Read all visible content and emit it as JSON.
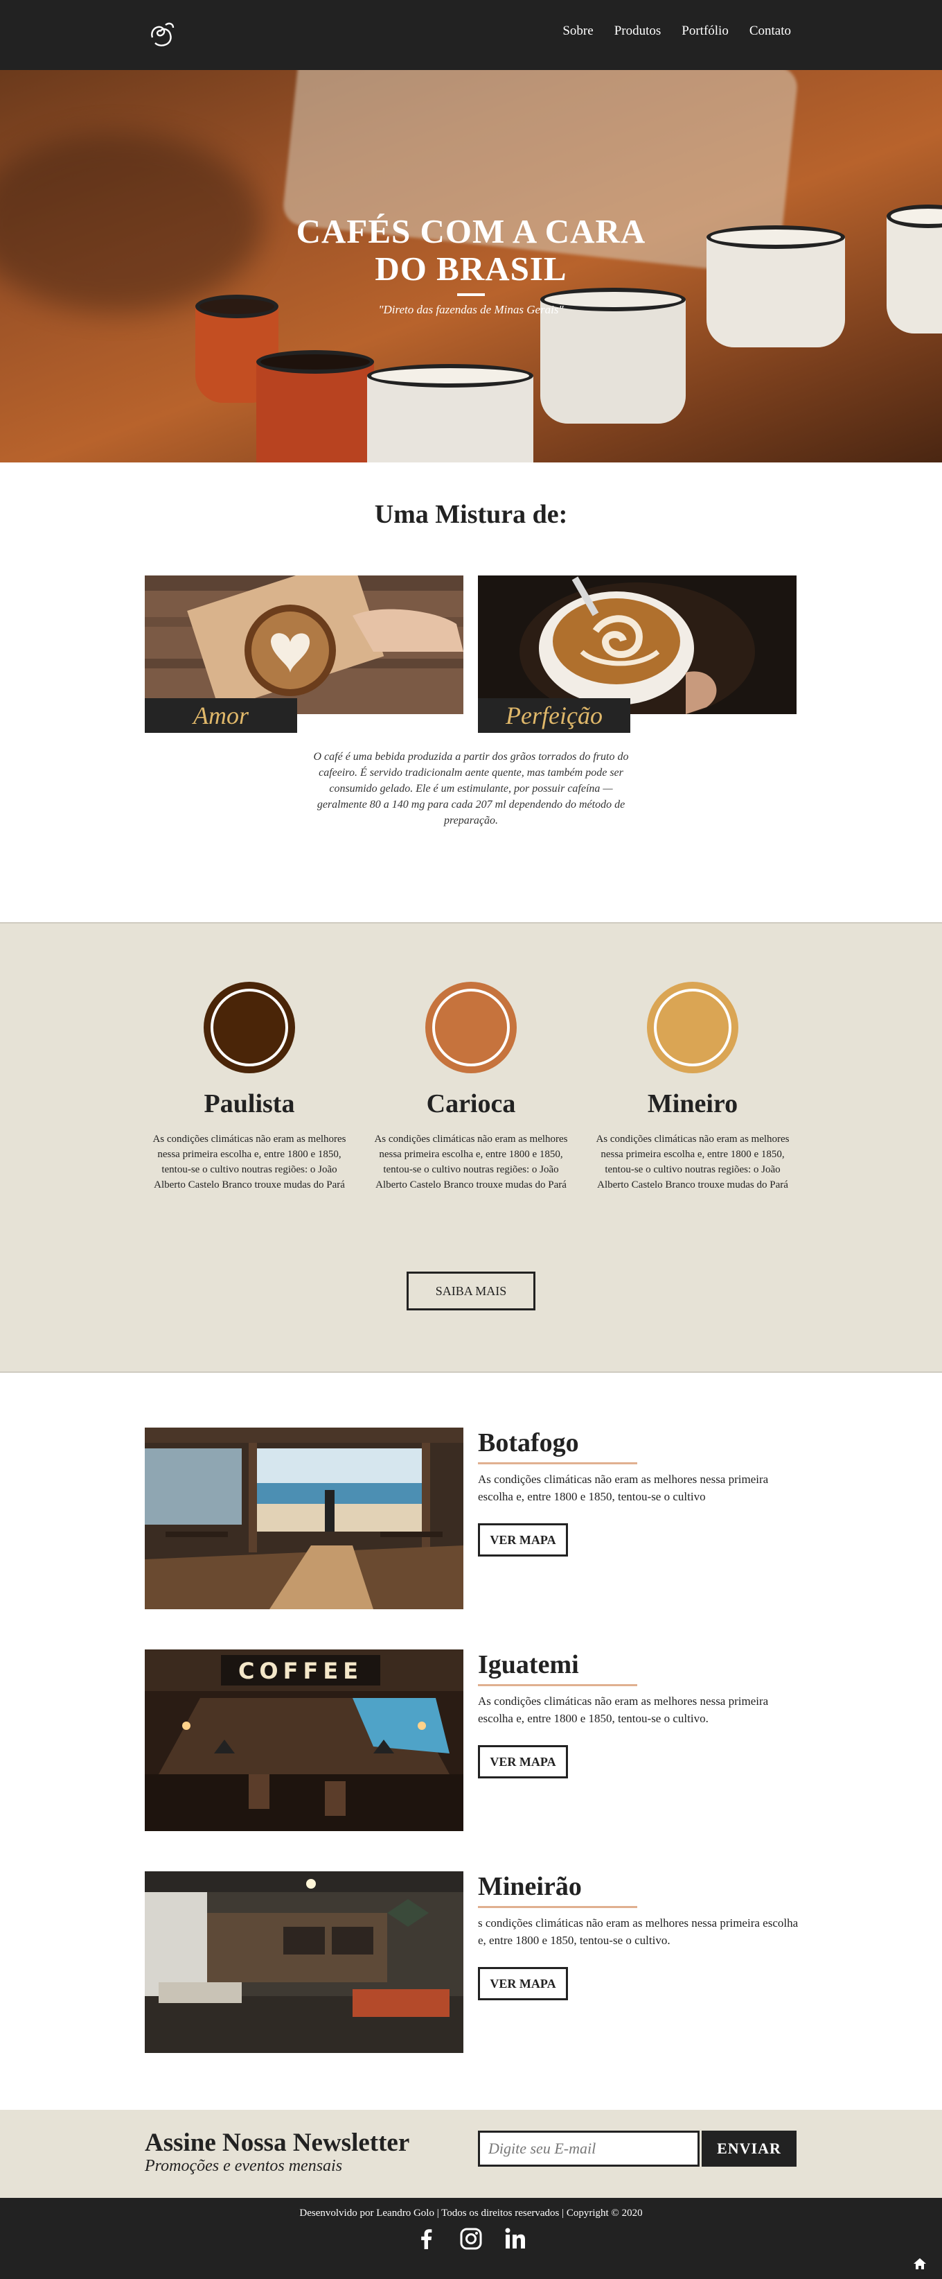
{
  "nav": {
    "items": [
      "Sobre",
      "Produtos",
      "Portfólio",
      "Contato"
    ]
  },
  "hero": {
    "title": "CAFÉS COM A CARA DO BRASIL",
    "subtitle": "\"Direto das fazendas de Minas Gerais\""
  },
  "mistura": {
    "title": "Uma Mistura de:",
    "cards": [
      {
        "label": "Amor"
      },
      {
        "label": "Perfeição"
      }
    ],
    "description": "O café é uma bebida produzida a partir dos grãos torrados do fruto do cafeeiro. É servido tradicionalm aente quente, mas também pode ser consumido gelado. Ele é um estimulante, por possuir cafeína — geralmente 80 a 140 mg para cada 207 ml dependendo do método de preparação."
  },
  "origens": {
    "items": [
      {
        "name": "Paulista",
        "color": "#4a2508",
        "text": "As condições climáticas não eram as melhores nessa primeira escolha e, entre 1800 e 1850, tentou-se o cultivo noutras regiões: o João Alberto Castelo Branco trouxe mudas do Pará"
      },
      {
        "name": "Carioca",
        "color": "#c6733d",
        "text": "As condições climáticas não eram as melhores nessa primeira escolha e, entre 1800 e 1850, tentou-se o cultivo noutras regiões: o João Alberto Castelo Branco trouxe mudas do Pará"
      },
      {
        "name": "Mineiro",
        "color": "#daa554",
        "text": "As condições climáticas não eram as melhores nessa primeira escolha e, entre 1800 e 1850, tentou-se o cultivo noutras regiões: o João Alberto Castelo Branco trouxe mudas do Pará"
      }
    ],
    "button": "SAIBA MAIS"
  },
  "lojas": [
    {
      "name": "Botafogo",
      "text": "As condições climáticas não eram as melhores nessa primeira escolha e, entre 1800 e 1850, tentou-se o cultivo",
      "button": "VER MAPA"
    },
    {
      "name": "Iguatemi",
      "text": "As condições climáticas não eram as melhores nessa primeira escolha e, entre 1800 e 1850, tentou-se o cultivo.",
      "button": "VER MAPA",
      "sign": "COFFEE"
    },
    {
      "name": "Mineirão",
      "text": "s condições climáticas não eram as melhores nessa primeira escolha e, entre 1800 e 1850, tentou-se o cultivo.",
      "button": "VER MAPA"
    }
  ],
  "newsletter": {
    "title": "Assine Nossa Newsletter",
    "subtitle": "Promoções e eventos mensais",
    "placeholder": "Digite seu E-mail",
    "button": "ENVIAR"
  },
  "footer": {
    "credits": "Desenvolvido por Leandro Golo | Todos os direitos reservados | Copyright © 2020",
    "social": [
      "facebook-icon",
      "instagram-icon",
      "linkedin-icon"
    ]
  }
}
